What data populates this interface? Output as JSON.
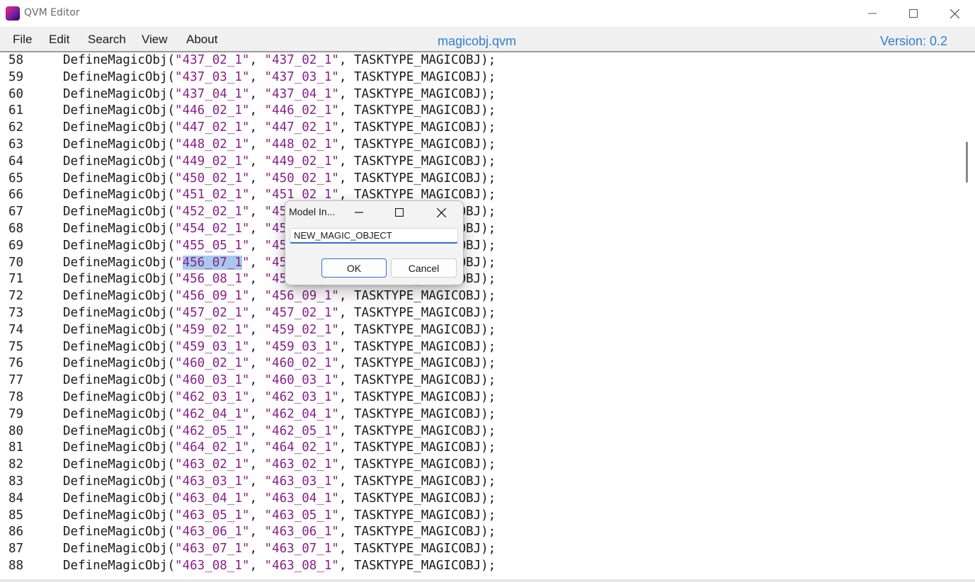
{
  "window": {
    "title": "QVM Editor",
    "minimize_icon": "minimize-icon",
    "maximize_icon": "maximize-icon",
    "close_icon": "close-icon"
  },
  "menubar": {
    "items": [
      "File",
      "Edit",
      "Search",
      "View",
      "About"
    ],
    "file_name": "magicobj.qvm",
    "version": "Version: 0.2"
  },
  "editor": {
    "selected_line": "70",
    "selected_text": "456_07_1",
    "lines": [
      {
        "num": "58",
        "a": "437_02_1",
        "b": "437_02_1"
      },
      {
        "num": "59",
        "a": "437_03_1",
        "b": "437_03_1"
      },
      {
        "num": "60",
        "a": "437_04_1",
        "b": "437_04_1"
      },
      {
        "num": "61",
        "a": "446_02_1",
        "b": "446_02_1"
      },
      {
        "num": "62",
        "a": "447_02_1",
        "b": "447_02_1"
      },
      {
        "num": "63",
        "a": "448_02_1",
        "b": "448_02_1"
      },
      {
        "num": "64",
        "a": "449_02_1",
        "b": "449_02_1"
      },
      {
        "num": "65",
        "a": "450_02_1",
        "b": "450_02_1"
      },
      {
        "num": "66",
        "a": "451_02_1",
        "b": "451_02_1"
      },
      {
        "num": "67",
        "a": "452_02_1",
        "b": "452_02_1"
      },
      {
        "num": "68",
        "a": "454_02_1",
        "b": "454_02_1"
      },
      {
        "num": "69",
        "a": "455_05_1",
        "b": "455_05_1"
      },
      {
        "num": "70",
        "a": "456_07_1",
        "b": "456_07_1"
      },
      {
        "num": "71",
        "a": "456_08_1",
        "b": "456_08_1"
      },
      {
        "num": "72",
        "a": "456_09_1",
        "b": "456_09_1"
      },
      {
        "num": "73",
        "a": "457_02_1",
        "b": "457_02_1"
      },
      {
        "num": "74",
        "a": "459_02_1",
        "b": "459_02_1"
      },
      {
        "num": "75",
        "a": "459_03_1",
        "b": "459_03_1"
      },
      {
        "num": "76",
        "a": "460_02_1",
        "b": "460_02_1"
      },
      {
        "num": "77",
        "a": "460_03_1",
        "b": "460_03_1"
      },
      {
        "num": "78",
        "a": "462_03_1",
        "b": "462_03_1"
      },
      {
        "num": "79",
        "a": "462_04_1",
        "b": "462_04_1"
      },
      {
        "num": "80",
        "a": "462_05_1",
        "b": "462_05_1"
      },
      {
        "num": "81",
        "a": "464_02_1",
        "b": "464_02_1"
      },
      {
        "num": "82",
        "a": "463_02_1",
        "b": "463_02_1"
      },
      {
        "num": "83",
        "a": "463_03_1",
        "b": "463_03_1"
      },
      {
        "num": "84",
        "a": "463_04_1",
        "b": "463_04_1"
      },
      {
        "num": "85",
        "a": "463_05_1",
        "b": "463_05_1"
      },
      {
        "num": "86",
        "a": "463_06_1",
        "b": "463_06_1"
      },
      {
        "num": "87",
        "a": "463_07_1",
        "b": "463_07_1"
      },
      {
        "num": "88",
        "a": "463_08_1",
        "b": "463_08_1"
      }
    ],
    "function_name": "DefineMagicObj",
    "task_type": "TASKTYPE_MAGICOBJ"
  },
  "dialog": {
    "title": "Model In...",
    "input_value": "NEW_MAGIC_OBJECT",
    "ok_label": "OK",
    "cancel_label": "Cancel"
  },
  "colors": {
    "accent": "#2f7fd0",
    "string": "#8a1f8a",
    "selection": "#a9c9ec",
    "menubar_bg": "#f0f0f0"
  }
}
